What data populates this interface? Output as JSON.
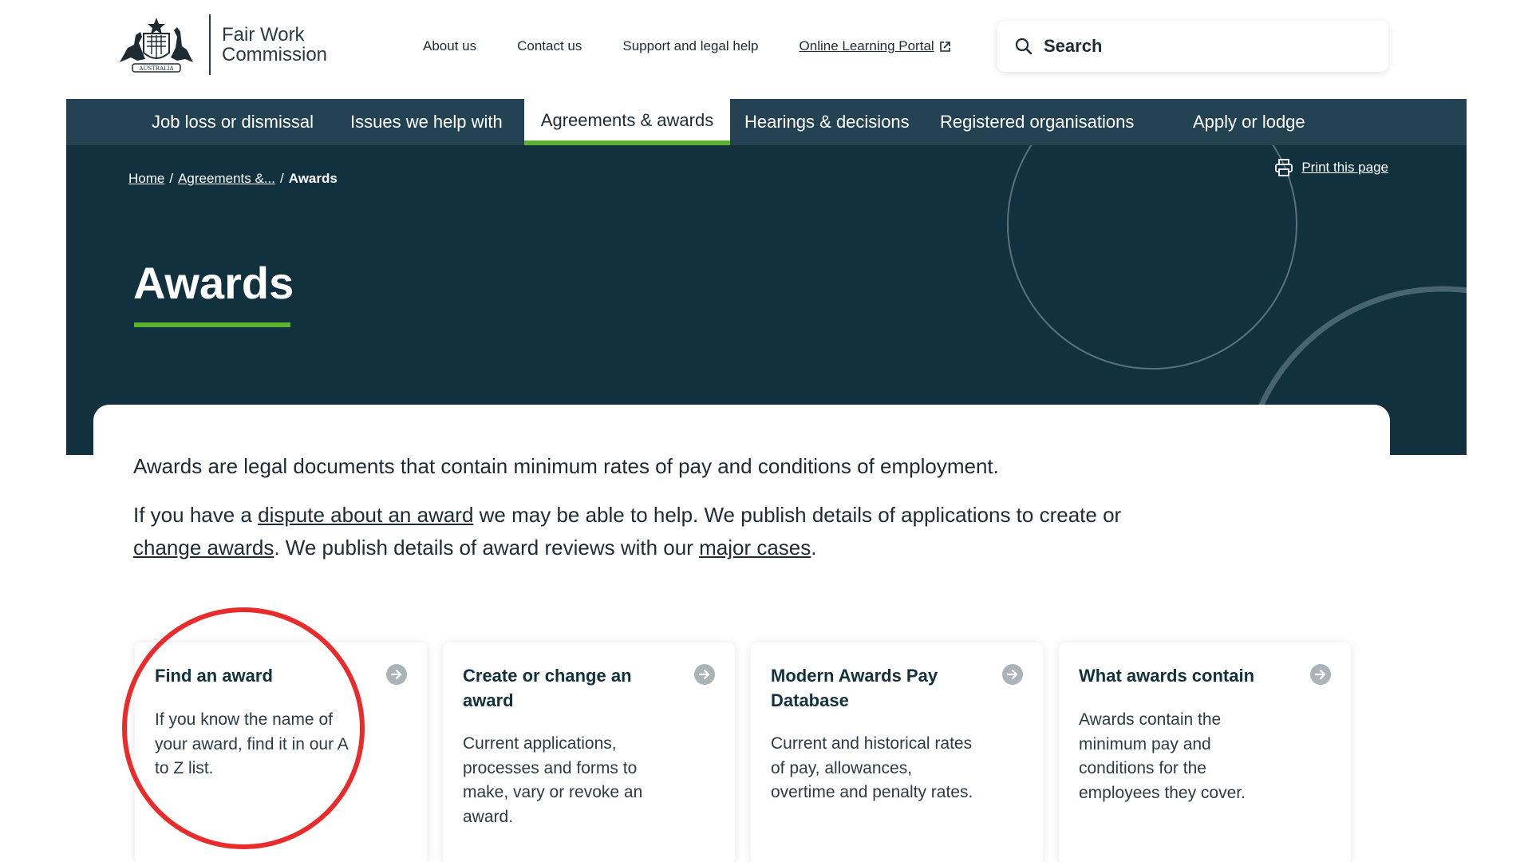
{
  "logo": {
    "line1": "Fair Work",
    "line2": "Commission",
    "crest_text": "AUSTRALIA"
  },
  "top_links": {
    "about": "About us",
    "contact": "Contact us",
    "support": "Support and legal help",
    "portal": "Online Learning Portal"
  },
  "search": {
    "label": "Search"
  },
  "nav": {
    "items": [
      {
        "label": "Job loss or dismissal"
      },
      {
        "label": "Issues we help with"
      },
      {
        "label": "Agreements & awards",
        "active": true
      },
      {
        "label": "Hearings & decisions"
      },
      {
        "label": "Registered organisations"
      },
      {
        "label": "Apply or lodge"
      }
    ]
  },
  "breadcrumb": {
    "home": "Home",
    "sep": "/",
    "parent": "Agreements &...",
    "current": "Awards"
  },
  "print": {
    "label": "Print this page"
  },
  "hero": {
    "title": "Awards"
  },
  "intro": {
    "line1": "Awards are legal documents that contain minimum rates of pay and conditions of employment.",
    "p2_a": "If you have a ",
    "p2_link1": "dispute about an award",
    "p2_b": " we may be able to help. We publish details of applications to create or ",
    "p2_link2": "change awards",
    "p2_c": ". We publish details of award reviews with our ",
    "p2_link3": "major cases",
    "p2_d": "."
  },
  "cards": [
    {
      "title": "Find an award",
      "text": "If you know the name of your award, find it in our A to Z list."
    },
    {
      "title": "Create or change an award",
      "text": "Current applications, processes and forms to make, vary or revoke an award."
    },
    {
      "title": "Modern Awards Pay Database",
      "text": "Current and historical rates of pay, allowances, overtime and penalty rates."
    },
    {
      "title": "What awards contain",
      "text": "Awards contain the minimum pay and conditions for the employees they cover."
    }
  ],
  "colors": {
    "nav_bg": "#234352",
    "hero_bg": "#11313e",
    "accent_green": "#5cb22f",
    "highlight_red": "#ea2b2b"
  }
}
